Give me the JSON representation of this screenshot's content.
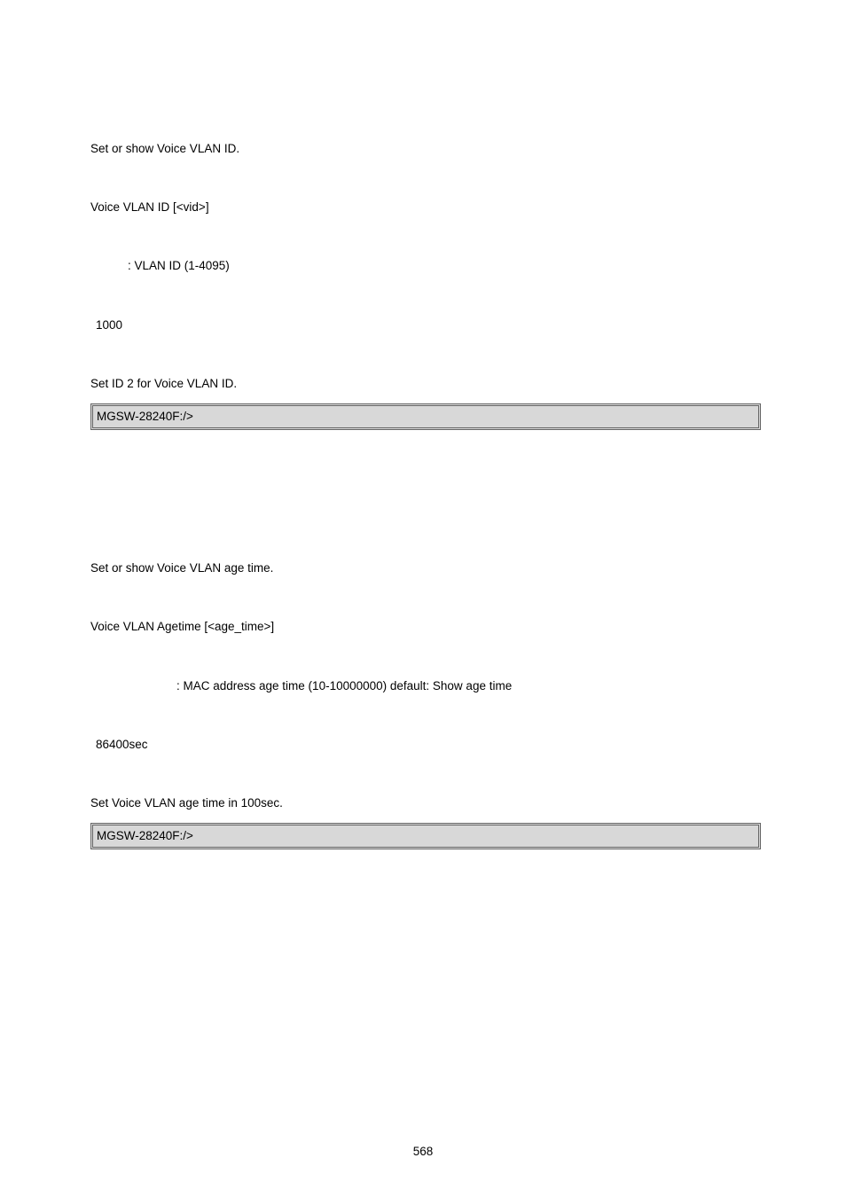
{
  "section1": {
    "desc": "Set or show Voice VLAN ID.",
    "syntax": "Voice VLAN ID [<vid>]",
    "param": ": VLAN ID (1-4095)",
    "default": "1000",
    "example_desc": "Set ID 2 for Voice VLAN ID.",
    "code": "MGSW-28240F:/>"
  },
  "section2": {
    "desc": "Set or show Voice VLAN age time.",
    "syntax": "Voice VLAN Agetime [<age_time>]",
    "param": ": MAC address age time (10-10000000) default: Show age time",
    "default": "86400sec",
    "example_desc": "Set Voice VLAN age time in 100sec.",
    "code": "MGSW-28240F:/>"
  },
  "pagenum": "568"
}
